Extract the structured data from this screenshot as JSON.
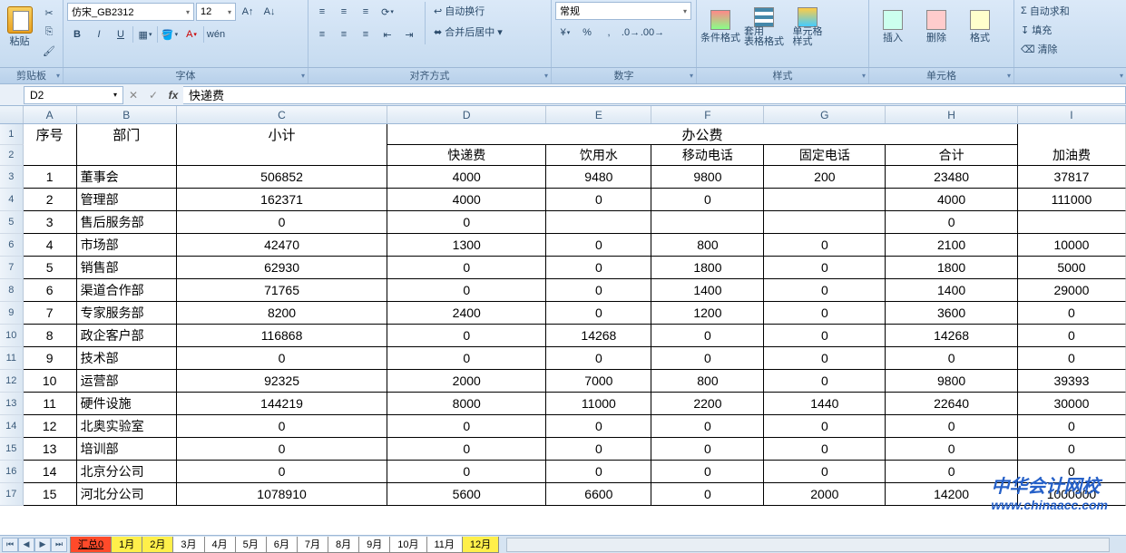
{
  "ribbon": {
    "clipboard": {
      "label": "剪贴板",
      "paste": "粘贴"
    },
    "font": {
      "label": "字体",
      "name": "仿宋_GB2312",
      "size": "12",
      "bold": "B",
      "italic": "I",
      "underline": "U",
      "pinyin": "wén"
    },
    "align": {
      "label": "对齐方式",
      "wrap": "自动换行",
      "merge": "合并后居中"
    },
    "number": {
      "label": "数字",
      "format": "常规"
    },
    "styles": {
      "label": "样式",
      "cond": "条件格式",
      "table": "套用\n表格格式",
      "cell": "单元格\n样式"
    },
    "cells": {
      "label": "单元格",
      "insert": "插入",
      "delete": "删除",
      "format": "格式"
    },
    "editing": {
      "label": "",
      "autosum": "自动求和",
      "fill": "填充",
      "clear": "清除"
    }
  },
  "namebox": "D2",
  "formula": "快递费",
  "columns": [
    "A",
    "B",
    "C",
    "D",
    "E",
    "F",
    "G",
    "H",
    "I"
  ],
  "headers": {
    "序号": "序号",
    "部门": "部门",
    "小计": "小计",
    "办公费": "办公费",
    "快递费": "快递费",
    "饮用水": "饮用水",
    "移动电话": "移动电话",
    "固定电话": "固定电话",
    "合计": "合计",
    "加油费": "加油费"
  },
  "rows": [
    {
      "n": "1",
      "dept": "董事会",
      "sub": "506852",
      "d": "4000",
      "e": "9480",
      "f": "9800",
      "g": "200",
      "h": "23480",
      "i": "37817"
    },
    {
      "n": "2",
      "dept": "管理部",
      "sub": "162371",
      "d": "4000",
      "e": "0",
      "f": "0",
      "g": "",
      "h": "4000",
      "i": "111000"
    },
    {
      "n": "3",
      "dept": "售后服务部",
      "sub": "0",
      "d": "0",
      "e": "",
      "f": "",
      "g": "",
      "h": "0",
      "i": ""
    },
    {
      "n": "4",
      "dept": "市场部",
      "sub": "42470",
      "d": "1300",
      "e": "0",
      "f": "800",
      "g": "0",
      "h": "2100",
      "i": "10000"
    },
    {
      "n": "5",
      "dept": "销售部",
      "sub": "62930",
      "d": "0",
      "e": "0",
      "f": "1800",
      "g": "0",
      "h": "1800",
      "i": "5000"
    },
    {
      "n": "6",
      "dept": "渠道合作部",
      "sub": "71765",
      "d": "0",
      "e": "0",
      "f": "1400",
      "g": "0",
      "h": "1400",
      "i": "29000"
    },
    {
      "n": "7",
      "dept": "专家服务部",
      "sub": "8200",
      "d": "2400",
      "e": "0",
      "f": "1200",
      "g": "0",
      "h": "3600",
      "i": "0"
    },
    {
      "n": "8",
      "dept": "政企客户部",
      "sub": "116868",
      "d": "0",
      "e": "14268",
      "f": "0",
      "g": "0",
      "h": "14268",
      "i": "0"
    },
    {
      "n": "9",
      "dept": "技术部",
      "sub": "0",
      "d": "0",
      "e": "0",
      "f": "0",
      "g": "0",
      "h": "0",
      "i": "0"
    },
    {
      "n": "10",
      "dept": "运营部",
      "sub": "92325",
      "d": "2000",
      "e": "7000",
      "f": "800",
      "g": "0",
      "h": "9800",
      "i": "39393"
    },
    {
      "n": "11",
      "dept": "硬件设施",
      "sub": "144219",
      "d": "8000",
      "e": "11000",
      "f": "2200",
      "g": "1440",
      "h": "22640",
      "i": "30000"
    },
    {
      "n": "12",
      "dept": "北奥实验室",
      "sub": "0",
      "d": "0",
      "e": "0",
      "f": "0",
      "g": "0",
      "h": "0",
      "i": "0"
    },
    {
      "n": "13",
      "dept": "培训部",
      "sub": "0",
      "d": "0",
      "e": "0",
      "f": "0",
      "g": "0",
      "h": "0",
      "i": "0"
    },
    {
      "n": "14",
      "dept": "北京分公司",
      "sub": "0",
      "d": "0",
      "e": "0",
      "f": "0",
      "g": "0",
      "h": "0",
      "i": "0"
    },
    {
      "n": "15",
      "dept": "河北分公司",
      "sub": "1078910",
      "d": "5600",
      "e": "6600",
      "f": "0",
      "g": "2000",
      "h": "14200",
      "i": "1000000"
    }
  ],
  "tabs": [
    "汇总0",
    "1月",
    "2月",
    "3月",
    "4月",
    "5月",
    "6月",
    "7月",
    "8月",
    "9月",
    "10月",
    "11月",
    "12月"
  ],
  "watermark": {
    "t1": "中华会计网校",
    "t2": "www.chinaacc.com"
  }
}
